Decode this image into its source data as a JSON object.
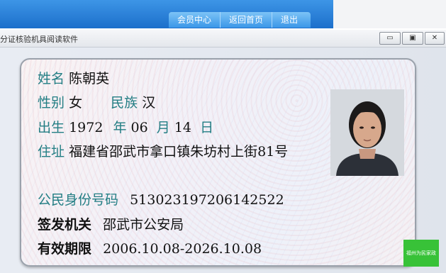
{
  "header": {
    "nav": [
      "会员中心",
      "返回首页",
      "退出"
    ]
  },
  "window": {
    "title": "分证核验机具阅读软件",
    "buttons": {
      "minimize": "▭",
      "maximize": "▣",
      "close": "✕"
    }
  },
  "card": {
    "name_label": "姓名",
    "name": "陈朝英",
    "sex_label": "性别",
    "sex": "女",
    "ethnic_label": "民族",
    "ethnic": "汉",
    "birth_label": "出生",
    "birth_year": "1972",
    "year_label": "年",
    "birth_month": "06",
    "month_label": "月",
    "birth_day": "14",
    "day_label": "日",
    "address_label": "住址",
    "address": "福建省邵武市拿口镇朱坊村上街81号",
    "id_label": "公民身份号码",
    "id_number": "513023197206142522",
    "authority_label": "签发机关",
    "authority": "邵武市公安局",
    "validity_label": "有效期限",
    "validity": "2006.10.08-2026.10.08",
    "photo_icon": "portrait-photo"
  },
  "badge": {
    "text": "福州为民家政"
  },
  "colors": {
    "label": "#237e84",
    "header_blue": "#1c6fcb",
    "badge_green": "#38c238"
  }
}
